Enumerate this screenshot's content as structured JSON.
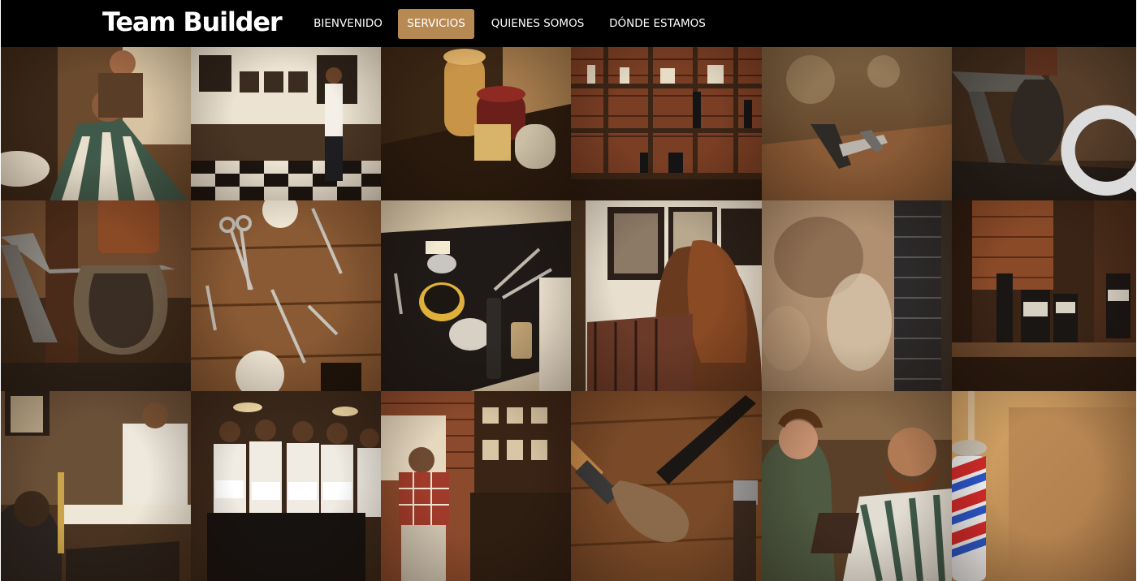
{
  "site": {
    "brand": "Team Builder"
  },
  "nav": {
    "items": [
      {
        "label": "BIENVENIDO",
        "active": false
      },
      {
        "label": "SERVICIOS",
        "active": true
      },
      {
        "label": "QUIENES SOMOS",
        "active": false
      },
      {
        "label": "DÓNDE ESTAMOS",
        "active": false
      }
    ],
    "active_color": "#b88a53"
  },
  "gallery": {
    "tiles": [
      {
        "subject": "barber cutting hair of client in striped cape",
        "icon": "photo-icon"
      },
      {
        "subject": "barbershop interior with checkered floor",
        "icon": "photo-icon"
      },
      {
        "subject": "tins of pomade on shelf",
        "icon": "photo-icon"
      },
      {
        "subject": "shelves with bottles against brick wall",
        "icon": "photo-icon"
      },
      {
        "subject": "straight razor on wooden table",
        "icon": "photo-icon"
      },
      {
        "subject": "shaving brush on stand with zoom overlay",
        "icon": "search-icon"
      },
      {
        "subject": "shaving brush on metal stand",
        "icon": "photo-icon"
      },
      {
        "subject": "scissors and clippers on wooden planks",
        "icon": "photo-icon"
      },
      {
        "subject": "barber tools and pomade on black towel",
        "icon": "photo-icon"
      },
      {
        "subject": "woman barber with framed portraits",
        "icon": "photo-icon"
      },
      {
        "subject": "blurred shop with dark brick column",
        "icon": "photo-icon"
      },
      {
        "subject": "grooming products on shelf by brick wall",
        "icon": "photo-icon"
      },
      {
        "subject": "barber styling client in shop",
        "icon": "photo-icon"
      },
      {
        "subject": "team of barbers holding towels",
        "icon": "photo-icon"
      },
      {
        "subject": "man in plaid shirt in front of brick shelves",
        "icon": "photo-icon"
      },
      {
        "subject": "shaving brush and razor on wood",
        "icon": "photo-icon"
      },
      {
        "subject": "barber trimming bearded client",
        "icon": "photo-icon"
      },
      {
        "subject": "barber pole close-up",
        "icon": "photo-icon"
      }
    ]
  }
}
